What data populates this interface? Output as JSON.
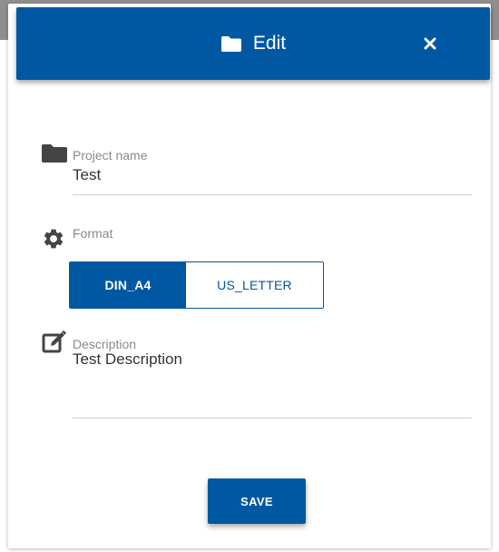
{
  "header": {
    "title": "Edit",
    "title_icon": "folder-icon",
    "close_icon": "close-icon"
  },
  "fields": {
    "project_name": {
      "label": "Project name",
      "value": "Test",
      "icon": "folder-icon"
    },
    "format": {
      "label": "Format",
      "icon": "gear-icon",
      "options": [
        "DIN_A4",
        "US_LETTER"
      ],
      "selected": "DIN_A4"
    },
    "description": {
      "label": "Description",
      "value": "Test Description",
      "icon": "edit-icon"
    }
  },
  "actions": {
    "save_label": "SAVE"
  },
  "colors": {
    "primary": "#0058a3",
    "label": "#8a8a8a",
    "text": "#333333",
    "divider": "#cfcfcf"
  }
}
